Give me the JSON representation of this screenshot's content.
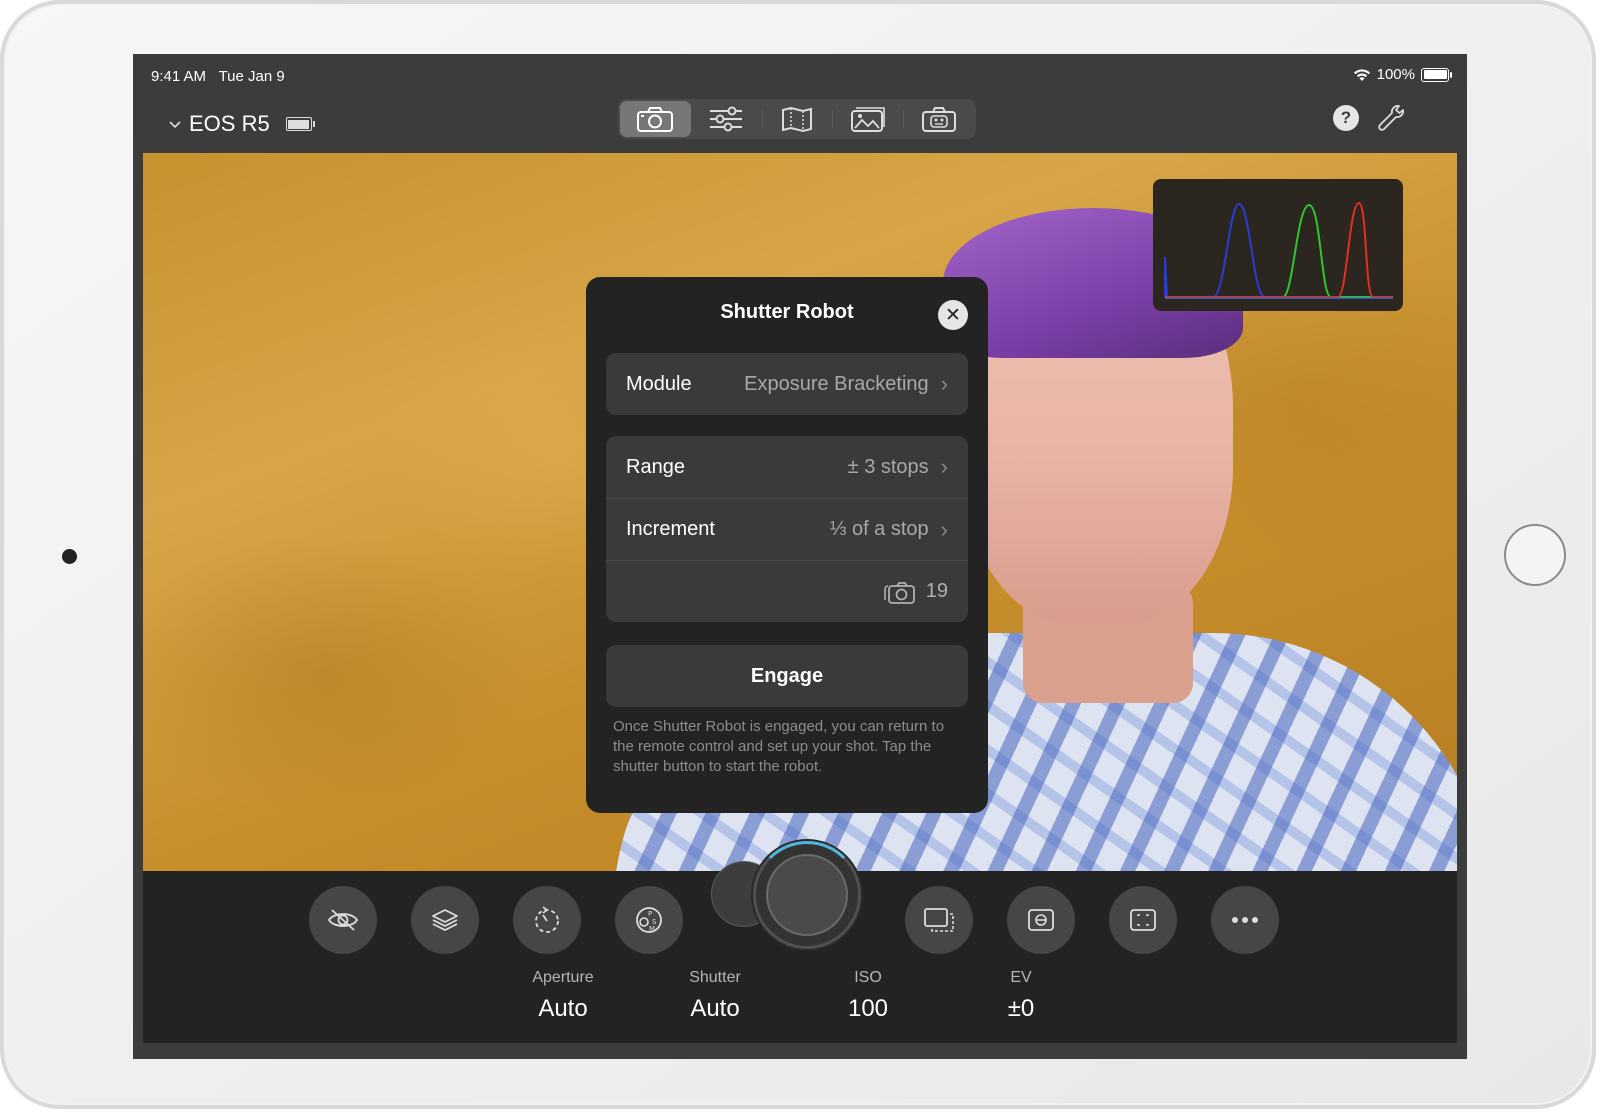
{
  "status_bar": {
    "time": "9:41 AM",
    "date": "Tue Jan 9",
    "battery": "100%"
  },
  "nav": {
    "camera_name": "EOS R5",
    "tabs": [
      {
        "icon": "camera-icon",
        "active": true
      },
      {
        "icon": "sliders-icon",
        "active": false
      },
      {
        "icon": "map-icon",
        "active": false
      },
      {
        "icon": "gallery-icon",
        "active": false
      },
      {
        "icon": "camera-robot-icon",
        "active": false
      }
    ],
    "help_label": "?"
  },
  "histogram": {
    "channels": [
      "red",
      "green",
      "blue"
    ],
    "colors": {
      "red": "#e03020",
      "green": "#2ec82e",
      "blue": "#2a3cd8"
    }
  },
  "robot_panel": {
    "title": "Shutter Robot",
    "close_label": "✕",
    "module": {
      "label": "Module",
      "value": "Exposure Bracketing"
    },
    "range": {
      "label": "Range",
      "value": "± 3 stops"
    },
    "increment": {
      "label": "Increment",
      "value": "⅓ of a stop"
    },
    "shot_count": "19",
    "engage_label": "Engage",
    "note": "Once Shutter Robot is engaged, you can return to the remote control and set up your shot. Tap the shutter button to start the robot."
  },
  "bottom_bar": {
    "buttons": [
      "eye-slash-icon",
      "layers-icon",
      "timer-icon",
      "mode-dial-icon",
      "drive-mode-icon",
      "metering-icon",
      "focus-area-icon",
      "more-icon"
    ],
    "exposure": [
      {
        "label": "Aperture",
        "value": "Auto"
      },
      {
        "label": "Shutter",
        "value": "Auto"
      },
      {
        "label": "ISO",
        "value": "100"
      },
      {
        "label": "EV",
        "value": "±0"
      }
    ]
  },
  "colors": {
    "accent": "#4fb6d8",
    "panel": "#232323",
    "row": "#3a3a3a"
  }
}
